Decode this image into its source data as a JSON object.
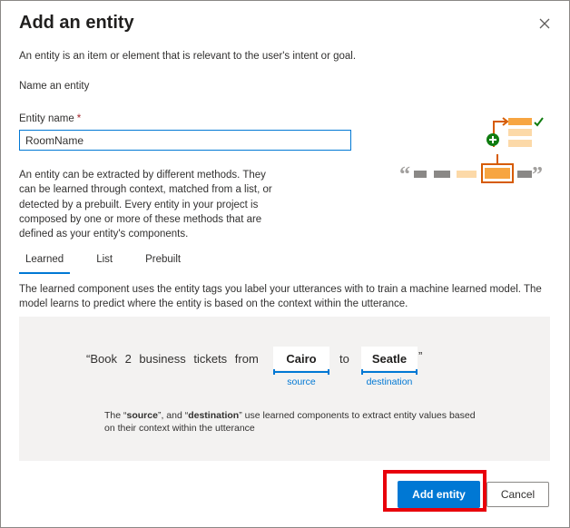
{
  "dialog": {
    "title": "Add an entity",
    "intro": "An entity is an item or element that is relevant to the user's intent or goal.",
    "section_heading": "Name an entity",
    "entity_name_label": "Entity name",
    "required_marker": "*",
    "entity_name_value": "RoomName",
    "methods_description": "An entity can be extracted by different methods. They can be learned through context, matched from a list, or detected by a prebuilt. Every entity in your project is composed by one or more of these methods that are defined as your entity's components."
  },
  "tabs": [
    {
      "label": "Learned",
      "active": true
    },
    {
      "label": "List",
      "active": false
    },
    {
      "label": "Prebuilt",
      "active": false
    }
  ],
  "learned": {
    "description": "The learned component uses the entity tags you label your utterances with to train a machine learned model. The model learns to predict where the entity is based on the context within the utterance.",
    "utterance_prefix": "“Book  2  business  tickets  from",
    "connector": "to",
    "utterance_suffix": "”",
    "chips": [
      {
        "text": "Cairo",
        "caption": "source"
      },
      {
        "text": "Seatle",
        "caption": "destination"
      }
    ],
    "note_part1": "The “",
    "note_source": "source",
    "note_part2": "”, and “",
    "note_destination": "destination",
    "note_part3": "” use learned components to extract entity values based on their context within the utterance"
  },
  "footer": {
    "add_label": "Add entity",
    "cancel_label": "Cancel"
  },
  "colors": {
    "accent": "#0078d4",
    "highlight": "#e8000b",
    "illustration_orange": "#f7a541",
    "illustration_green": "#107c10"
  },
  "icons": [
    "close-icon",
    "entity-illustration"
  ]
}
